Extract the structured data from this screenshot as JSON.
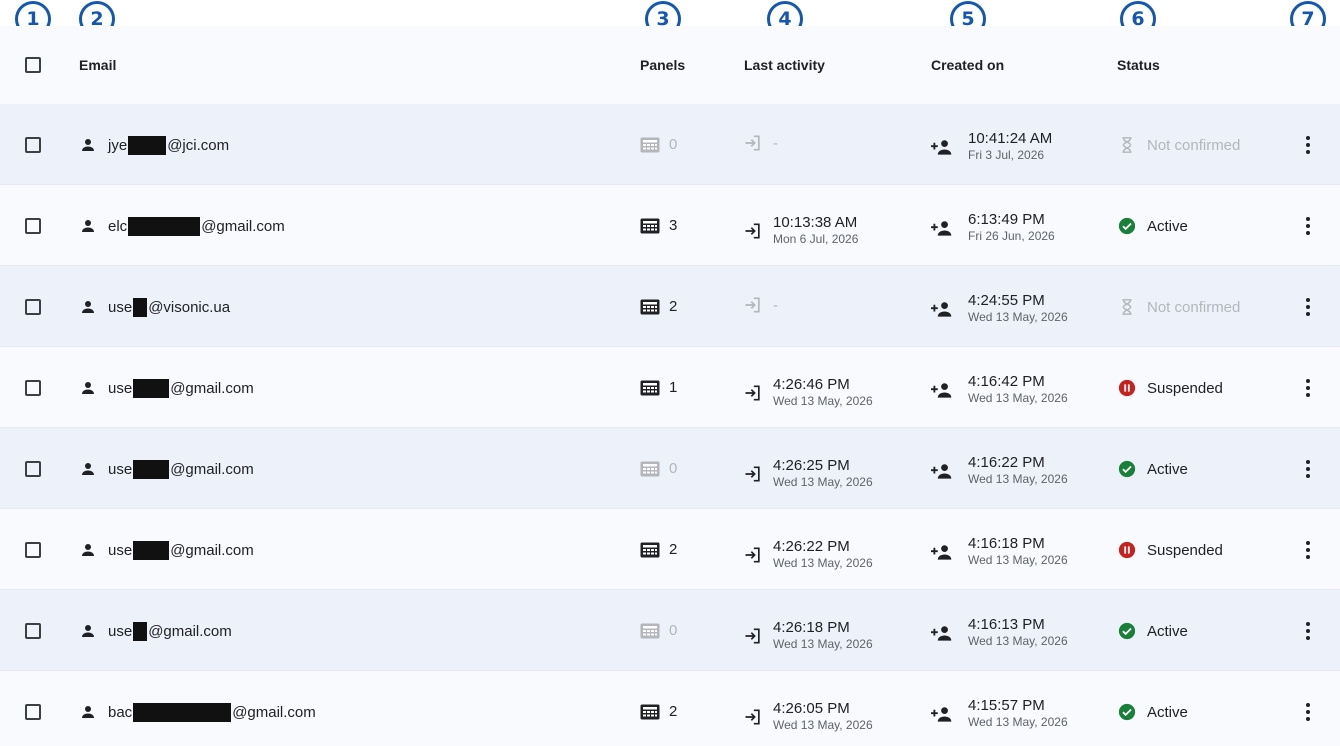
{
  "annotations": [
    "1",
    "2",
    "3",
    "4",
    "5",
    "6",
    "7"
  ],
  "header": {
    "email": "Email",
    "panels": "Panels",
    "last_activity": "Last activity",
    "created_on": "Created on",
    "status": "Status"
  },
  "colors": {
    "active": "#188038",
    "suspended": "#c5221f",
    "not_confirmed": "#b3b6bb",
    "annotation": "#1557b0"
  },
  "icons": {
    "user": "person-icon",
    "panel": "panel-icon",
    "activity": "login-icon",
    "created": "person-add-icon",
    "status_active": "check-circle-icon",
    "status_suspended": "pause-circle-icon",
    "status_not_confirmed": "hourglass-icon",
    "row_menu": "more-vert-icon"
  },
  "rows": [
    {
      "email_prefix": "jye",
      "email_suffix": "@jci.com",
      "panels": "0",
      "activity_time": "-",
      "activity_date": "",
      "created_time": "10:41:24 AM",
      "created_date": "Fri 3 Jul, 2026",
      "status": "Not confirmed"
    },
    {
      "email_prefix": "elc",
      "email_suffix": "@gmail.com",
      "panels": "3",
      "activity_time": "10:13:38 AM",
      "activity_date": "Mon 6 Jul, 2026",
      "created_time": "6:13:49 PM",
      "created_date": "Fri 26 Jun, 2026",
      "status": "Active"
    },
    {
      "email_prefix": "use",
      "email_suffix": "@visonic.ua",
      "panels": "2",
      "activity_time": "-",
      "activity_date": "",
      "created_time": "4:24:55 PM",
      "created_date": "Wed 13 May, 2026",
      "status": "Not confirmed"
    },
    {
      "email_prefix": "use",
      "email_suffix": "@gmail.com",
      "panels": "1",
      "activity_time": "4:26:46 PM",
      "activity_date": "Wed 13 May, 2026",
      "created_time": "4:16:42 PM",
      "created_date": "Wed 13 May, 2026",
      "status": "Suspended"
    },
    {
      "email_prefix": "use",
      "email_suffix": "@gmail.com",
      "panels": "0",
      "activity_time": "4:26:25 PM",
      "activity_date": "Wed 13 May, 2026",
      "created_time": "4:16:22 PM",
      "created_date": "Wed 13 May, 2026",
      "status": "Active"
    },
    {
      "email_prefix": "use",
      "email_suffix": "@gmail.com",
      "panels": "2",
      "activity_time": "4:26:22 PM",
      "activity_date": "Wed 13 May, 2026",
      "created_time": "4:16:18 PM",
      "created_date": "Wed 13 May, 2026",
      "status": "Suspended"
    },
    {
      "email_prefix": "use",
      "email_suffix": "@gmail.com",
      "panels": "0",
      "activity_time": "4:26:18 PM",
      "activity_date": "Wed 13 May, 2026",
      "created_time": "4:16:13 PM",
      "created_date": "Wed 13 May, 2026",
      "status": "Active"
    },
    {
      "email_prefix": "bac",
      "email_suffix": "@gmail.com",
      "panels": "2",
      "activity_time": "4:26:05 PM",
      "activity_date": "Wed 13 May, 2026",
      "created_time": "4:15:57 PM",
      "created_date": "Wed 13 May, 2026",
      "status": "Active"
    }
  ]
}
